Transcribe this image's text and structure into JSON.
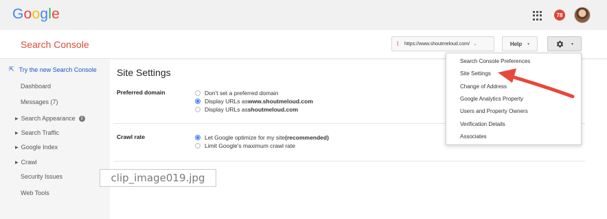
{
  "google_bar": {
    "logo_letters": [
      {
        "ch": "G",
        "color": "#4285f4"
      },
      {
        "ch": "o",
        "color": "#ea4335"
      },
      {
        "ch": "o",
        "color": "#fbbc05"
      },
      {
        "ch": "g",
        "color": "#4285f4"
      },
      {
        "ch": "l",
        "color": "#34a853"
      },
      {
        "ch": "e",
        "color": "#ea4335"
      }
    ],
    "notification_count": "78"
  },
  "header": {
    "title": "Search Console",
    "site_url": "https://www.shoutmeloud.com/",
    "help_label": "Help"
  },
  "sidebar": {
    "try_new": "Try the new Search Console",
    "items": [
      {
        "label": "Dashboard"
      },
      {
        "label": "Messages (7)"
      },
      {
        "label": "Search Appearance"
      },
      {
        "label": "Search Traffic"
      },
      {
        "label": "Google Index"
      },
      {
        "label": "Crawl"
      },
      {
        "label": "Security Issues"
      },
      {
        "label": "Web Tools"
      }
    ]
  },
  "main": {
    "title": "Site Settings",
    "preferred_domain": {
      "label": "Preferred domain",
      "options": [
        {
          "prefix": "Don't set a preferred domain",
          "bold": "",
          "selected": false
        },
        {
          "prefix": "Display URLs as ",
          "bold": "www.shoutmeloud.com",
          "selected": true
        },
        {
          "prefix": "Display URLs as ",
          "bold": "shoutmeloud.com",
          "selected": false
        }
      ]
    },
    "crawl_rate": {
      "label": "Crawl rate",
      "options": [
        {
          "prefix": "Let Google optimize for my site ",
          "bold": "(recommended)",
          "selected": true
        },
        {
          "prefix": "Limit Google's maximum crawl rate",
          "bold": "",
          "selected": false
        }
      ]
    }
  },
  "settings_menu": {
    "items": [
      "Search Console Preferences",
      "Site Settings",
      "Change of Address",
      "Google Analytics Property",
      "Users and Property Owners",
      "Verification Details",
      "Associates"
    ]
  },
  "caption": "clip_image019.jpg",
  "colors": {
    "console_red": "#dd4b39",
    "link_blue": "#1a55c8",
    "radio_blue": "#4285f4",
    "arrow_red": "#e8473b"
  }
}
